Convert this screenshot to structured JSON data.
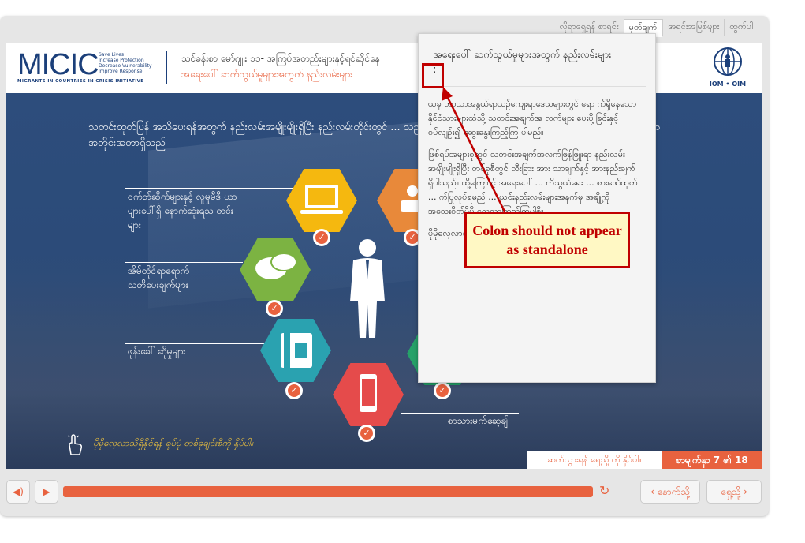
{
  "top_menu": [
    "လိုရာရှေ့ရန် စာရင်း",
    "မှတ်ချက်",
    "အရင်းအမြစ်များ",
    "ထွက်ပါ"
  ],
  "header": {
    "logo_text": "MICIC",
    "logo_tagline": [
      "Save Lives",
      "Increase Protection",
      "Decrease Vulnerability",
      "Improve Response"
    ],
    "logo_subtitle": "MIGRANTS IN COUNTRIES IN CRISIS INITIATIVE",
    "crumb_course": "သင်ခန်းစာ မော်ဂျူး ၁၁- အကြပ်အတည်းများနှင့်ရင်ဆိုင်နေ",
    "crumb_topic": "အရေးပေါ် ဆက်သွယ်မှုများအတွက် နည်းလမ်းများ",
    "iom_label": "IOM • OIM"
  },
  "intro_text": "သတင်းထုတ်ပြန် အသိပေးရန်အတွက် နည်းလမ်းအမျိုးမျိုးရှိပြီး နည်းလမ်းတိုင်းတွင် ... သည်။ အရေးပေါ် ဆက်သွယ်မှု မဟာဗျူဟာတစ်ခုတွင် ကျယ်ပြန့်သော အတိုင်းအတာရှိသည်",
  "items": {
    "social_media": "ဝက်ဘ်ဆိုက်များနှင့် လူမှုမီဒီ ယာများပေါ်ရှိ နောက်ဆုံးရသ တင်းများ",
    "local_info": "အိမ်တိုင်ရာရောက် သတိပေးချက်များ",
    "phone": "ဖုန်းခေါ် ဆိုမှုများ",
    "sms": "စာသားမက်ဆေ့ချ်"
  },
  "hint": "ပိုမိုလေ့လာသိရှိနိုင်ရန် ရုပ်ပုံ တစ်ခုချင်းစီကို နှိပ်ပါ။",
  "footer": {
    "instruction": "ဆက်သွားရန် ရှေ့သို့ ကို နှိပ်ပါ။",
    "page_indicator": "စာမျက်နှာ 7 ၏ 18"
  },
  "controls": {
    "back_label": "နောက်သို့",
    "next_label": "ရှေ့သို့",
    "progress_fraction": 0.98
  },
  "popup": {
    "title": "အရေးပေါ် ဆက်သွယ်မှုများအတွက် နည်းလမ်းများ",
    "colon": ":",
    "para1": "ယခု ဘာသာအနွယ်ရာယဉ်ကျေးရာဒေသများတွင် ရော က်ရှိနေသော နိုင်ငံသားများထံသို့ သတင်းအချက်အ လက်များ ပေးပို့ခြင်းနှင့် စပ်လျဉ်း၍ ဆွေးနွေးကြည့်ကြ ပါမည်။",
    "para2": "ဖြစ်ရပ်အများစုတွင် သတင်းအချက်အလက်ဖြန့်ဖြူးရာ နည်းလမ်းအမျိုးမျိုးရှိပြီး တစ်ခုစီတွင် သီးခြား အား သာချက်နှင့် အားနည်းချက် ရှိပါသည်။ ထို့ကြော င့် အရေးပေါ် ... ကိသွယ်ရေး ... စားဖော်ထုတ် ... က်ပြုလုပ်ရမည် ... ယင်းနည်းလမ်းများအနက်မှ အချို့ကို အသေးစိတ်ပိုမို လေ့လာကြည့်ကြပါစို့။",
    "para3": "ပိုမိုလေ့လာသိရှိနိုင်ရန် ရုပ်ပုံ တစ်ခုချင်းစီကို နှိပ်ပါ။"
  },
  "annotation": {
    "callout": "Colon should not appear as standalone"
  },
  "colors": {
    "accent": "#e8623f",
    "navy": "#1b3f7a",
    "annotation_red": "#c00000"
  }
}
